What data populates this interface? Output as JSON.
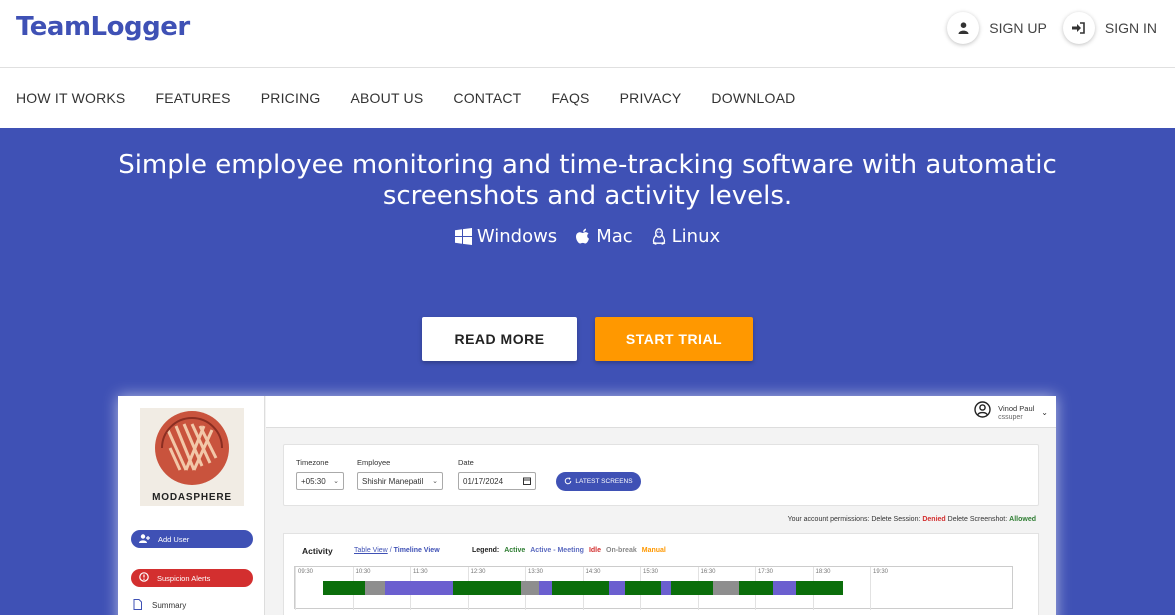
{
  "header": {
    "logo": "TeamLogger",
    "signup_label": "SIGN UP",
    "signin_label": "SIGN IN"
  },
  "nav": {
    "items": [
      "HOW IT WORKS",
      "FEATURES",
      "PRICING",
      "ABOUT US",
      "CONTACT",
      "FAQS",
      "PRIVACY",
      "DOWNLOAD"
    ]
  },
  "hero": {
    "headline_line1": "Simple employee monitoring and time-tracking software with automatic",
    "headline_line2": "screenshots and activity levels.",
    "platforms": {
      "windows": "Windows",
      "mac": "Mac",
      "linux": "Linux"
    },
    "read_more": "READ MORE",
    "start_trial": "START TRIAL",
    "colors": {
      "background": "#3F51B5",
      "accent": "#FF9800"
    }
  },
  "app": {
    "brand": "MODASPHERE",
    "sidebar": {
      "add_user": "Add User",
      "suspicion_alerts": "Suspicion Alerts",
      "summary": "Summary"
    },
    "user": {
      "name": "Vinod Paul",
      "role": "cssuper"
    },
    "filters": {
      "timezone_label": "Timezone",
      "timezone_value": "+05:30",
      "employee_label": "Employee",
      "employee_value": "Shishir Manepatil",
      "date_label": "Date",
      "date_value": "01/17/2024",
      "latest_label": "LATEST SCREENS"
    },
    "permissions": {
      "prefix": "Your account permissions:",
      "delete_session": "Delete Session:",
      "delete_session_value": "Denied",
      "delete_screenshot": "Delete Screenshot:",
      "delete_screenshot_value": "Allowed"
    },
    "activity": {
      "title": "Activity",
      "table_view": "Table View",
      "separator": "/",
      "timeline_view": "Timeline View",
      "legend_title": "Legend:",
      "legend_active": "Active",
      "legend_meeting": "Active - Meeting",
      "legend_idle": "Idle",
      "legend_break": "On-break",
      "legend_manual": "Manual",
      "ticks": [
        "09:30",
        "10:30",
        "11:30",
        "12:30",
        "13:30",
        "14:30",
        "15:30",
        "16:30",
        "17:30",
        "18:30",
        "19:30"
      ],
      "segments": [
        {
          "state": "active",
          "start": 0.0,
          "end": 0.08
        },
        {
          "state": "break",
          "start": 0.08,
          "end": 0.12
        },
        {
          "state": "meeting",
          "start": 0.12,
          "end": 0.25
        },
        {
          "state": "active",
          "start": 0.25,
          "end": 0.38
        },
        {
          "state": "break",
          "start": 0.38,
          "end": 0.415
        },
        {
          "state": "meeting",
          "start": 0.415,
          "end": 0.44
        },
        {
          "state": "active",
          "start": 0.44,
          "end": 0.55
        },
        {
          "state": "meeting",
          "start": 0.55,
          "end": 0.58
        },
        {
          "state": "active",
          "start": 0.58,
          "end": 0.65
        },
        {
          "state": "meeting",
          "start": 0.65,
          "end": 0.67
        },
        {
          "state": "active",
          "start": 0.67,
          "end": 0.75
        },
        {
          "state": "break",
          "start": 0.75,
          "end": 0.8
        },
        {
          "state": "active",
          "start": 0.8,
          "end": 0.865
        },
        {
          "state": "meeting",
          "start": 0.865,
          "end": 0.91
        },
        {
          "state": "active",
          "start": 0.91,
          "end": 1.0
        }
      ],
      "state_colors": {
        "active": "#0B6E0B",
        "meeting": "#6B5FCF",
        "break": "#8E8E8E"
      }
    }
  }
}
